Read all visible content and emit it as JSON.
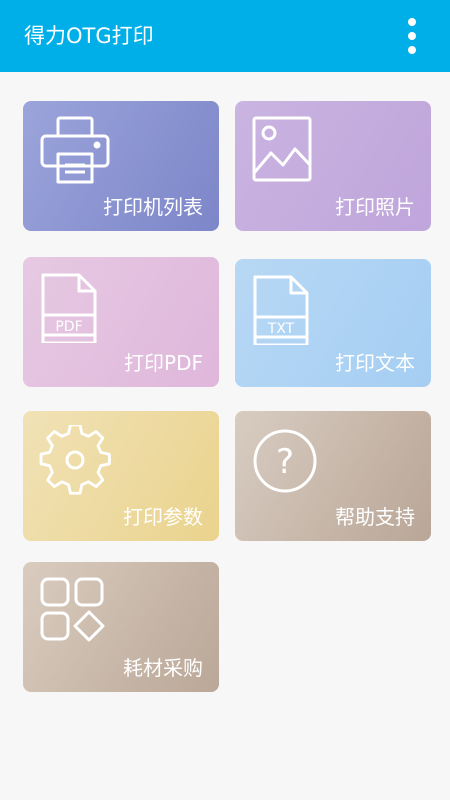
{
  "app": {
    "title": "得力OTG打印",
    "menu_icon": "more-vert-icon"
  },
  "tiles": [
    {
      "label": "打印机列表",
      "icon": "printer-icon"
    },
    {
      "label": "打印照片",
      "icon": "image-icon"
    },
    {
      "label": "打印PDF",
      "icon": "pdf-file-icon",
      "icon_text": "PDF"
    },
    {
      "label": "打印文本",
      "icon": "txt-file-icon",
      "icon_text": "TXT"
    },
    {
      "label": "打印参数",
      "icon": "gear-icon"
    },
    {
      "label": "帮助支持",
      "icon": "help-icon",
      "icon_text": "?"
    },
    {
      "label": "耗材采购",
      "icon": "grid-apps-icon"
    }
  ],
  "colors": {
    "appbar": "#00aee8",
    "background": "#f7f7f7",
    "tile_printer_list": "#8a93d1",
    "tile_photo": "#c5acde",
    "tile_pdf": "#e2bfdf",
    "tile_text": "#aad2f3",
    "tile_params": "#eedb9f",
    "tile_help": "#c8b8aa",
    "tile_supplies": "#c8b8aa"
  }
}
